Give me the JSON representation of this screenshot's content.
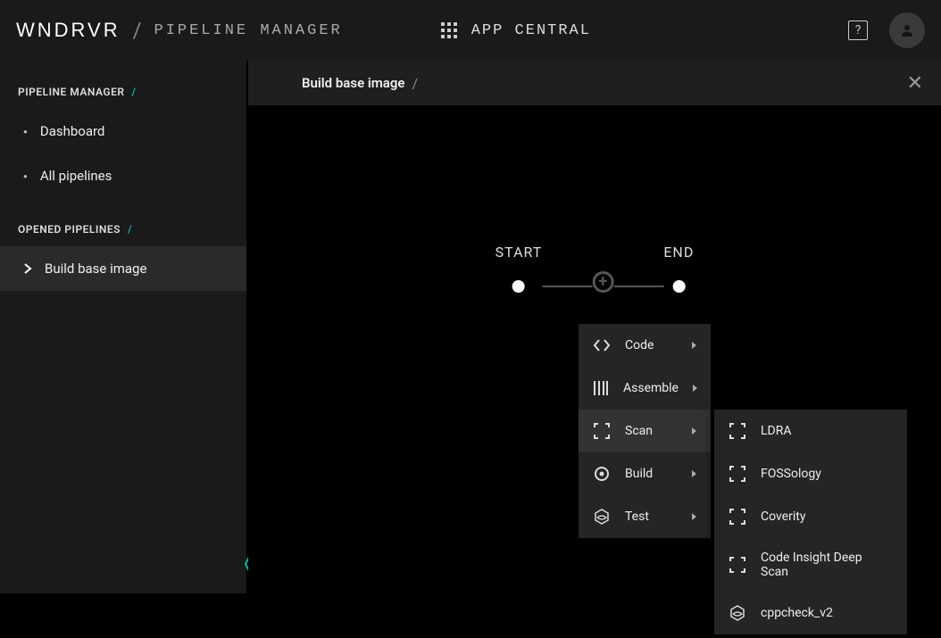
{
  "header": {
    "logo": "WNDRVR",
    "title": "PIPELINE MANAGER",
    "app_central": "APP CENTRAL"
  },
  "sidebar": {
    "section1_title": "PIPELINE MANAGER",
    "items": [
      "Dashboard",
      "All pipelines"
    ],
    "section2_title": "OPENED PIPELINES",
    "opened": [
      "Build base image"
    ]
  },
  "crumb": {
    "title": "Build base image"
  },
  "canvas": {
    "start_label": "START",
    "end_label": "END"
  },
  "menu": {
    "items": [
      {
        "label": "Code",
        "icon": "code"
      },
      {
        "label": "Assemble",
        "icon": "assemble"
      },
      {
        "label": "Scan",
        "icon": "scan",
        "hover": true
      },
      {
        "label": "Build",
        "icon": "build"
      },
      {
        "label": "Test",
        "icon": "test"
      }
    ]
  },
  "submenu": {
    "items": [
      {
        "label": "LDRA",
        "icon": "scan"
      },
      {
        "label": "FOSSology",
        "icon": "scan"
      },
      {
        "label": "Coverity",
        "icon": "scan"
      },
      {
        "label": "Code Insight Deep Scan",
        "icon": "scan"
      },
      {
        "label": "cppcheck_v2",
        "icon": "test"
      }
    ]
  }
}
